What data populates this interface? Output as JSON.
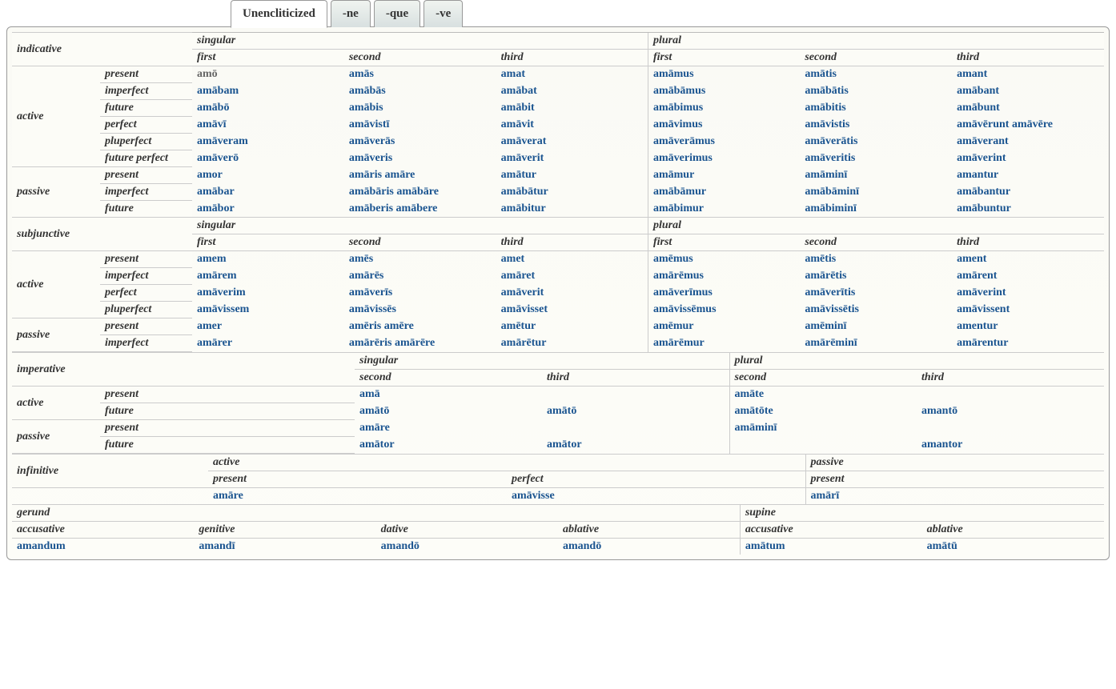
{
  "tabs": [
    "Unencliticized",
    "-ne",
    "-que",
    "-ve"
  ],
  "labels": {
    "indicative": "indicative",
    "subjunctive": "subjunctive",
    "imperative": "imperative",
    "infinitive": "infinitive",
    "gerund": "gerund",
    "supine": "supine",
    "active": "active",
    "passive": "passive",
    "singular": "singular",
    "plural": "plural",
    "first": "first",
    "second": "second",
    "third": "third",
    "present": "present",
    "imperfect": "imperfect",
    "future": "future",
    "perfect": "perfect",
    "pluperfect": "pluperfect",
    "future_perfect": "future perfect",
    "genitive": "genitive",
    "dative": "dative",
    "accusative": "accusative",
    "ablative": "ablative"
  },
  "indicative": {
    "active": {
      "present": [
        "amō",
        "amās",
        "amat",
        "amāmus",
        "amātis",
        "amant"
      ],
      "imperfect": [
        "amābam",
        "amābās",
        "amābat",
        "amābāmus",
        "amābātis",
        "amābant"
      ],
      "future": [
        "amābō",
        "amābis",
        "amābit",
        "amābimus",
        "amābitis",
        "amābunt"
      ],
      "perfect": [
        "amāvī",
        "amāvistī",
        "amāvit",
        "amāvimus",
        "amāvistis",
        "amāvērunt amāvēre"
      ],
      "pluperfect": [
        "amāveram",
        "amāverās",
        "amāverat",
        "amāverāmus",
        "amāverātis",
        "amāverant"
      ],
      "future_perfect": [
        "amāverō",
        "amāveris",
        "amāverit",
        "amāverimus",
        "amāveritis",
        "amāverint"
      ]
    },
    "passive": {
      "present": [
        "amor",
        "amāris amāre",
        "amātur",
        "amāmur",
        "amāminī",
        "amantur"
      ],
      "imperfect": [
        "amābar",
        "amābāris amābāre",
        "amābātur",
        "amābāmur",
        "amābāminī",
        "amābantur"
      ],
      "future": [
        "amābor",
        "amāberis amābere",
        "amābitur",
        "amābimur",
        "amābiminī",
        "amābuntur"
      ]
    }
  },
  "subjunctive": {
    "active": {
      "present": [
        "amem",
        "amēs",
        "amet",
        "amēmus",
        "amētis",
        "ament"
      ],
      "imperfect": [
        "amārem",
        "amārēs",
        "amāret",
        "amārēmus",
        "amārētis",
        "amārent"
      ],
      "perfect": [
        "amāverim",
        "amāverīs",
        "amāverit",
        "amāverīmus",
        "amāverītis",
        "amāverint"
      ],
      "pluperfect": [
        "amāvissem",
        "amāvissēs",
        "amāvisset",
        "amāvissēmus",
        "amāvissētis",
        "amāvissent"
      ]
    },
    "passive": {
      "present": [
        "amer",
        "amēris amēre",
        "amētur",
        "amēmur",
        "amēminī",
        "amentur"
      ],
      "imperfect": [
        "amārer",
        "amārēris amārēre",
        "amārētur",
        "amārēmur",
        "amārēminī",
        "amārentur"
      ]
    }
  },
  "imperative": {
    "active": {
      "present": {
        "s2": "amā",
        "pl2": "amāte"
      },
      "future": {
        "s2": "amātō",
        "s3": "amātō",
        "pl2": "amātōte",
        "pl3": "amantō"
      }
    },
    "passive": {
      "present": {
        "s2": "amāre",
        "pl2": "amāminī"
      },
      "future": {
        "s2": "amātor",
        "s3": "amātor",
        "pl3": "amantor"
      }
    }
  },
  "infinitive": {
    "active": {
      "present": "amāre",
      "perfect": "amāvisse"
    },
    "passive": {
      "present": "amārī"
    }
  },
  "gerund": {
    "accusative": "amandum",
    "genitive": "amandī",
    "dative": "amandō",
    "ablative": "amandō"
  },
  "supine_forms": {
    "accusative": "amātum",
    "ablative": "amātū"
  }
}
